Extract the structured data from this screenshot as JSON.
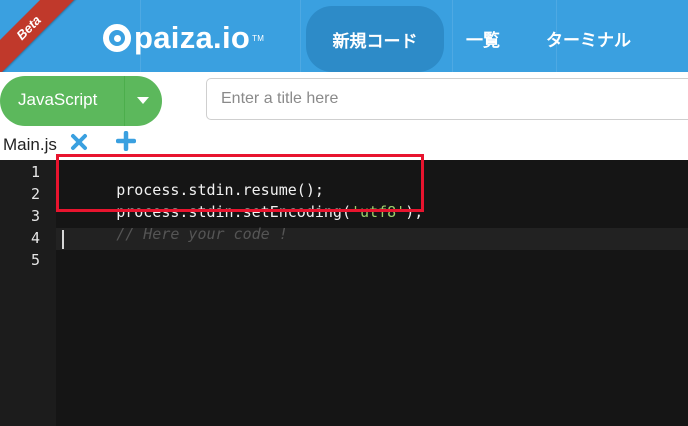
{
  "header": {
    "beta_label": "Beta",
    "logo_text": "paiza.io",
    "logo_tm": "TM",
    "nav": {
      "new_code": "新規コード",
      "list": "一覧",
      "terminal": "ターミナル"
    }
  },
  "toolbar": {
    "language": "JavaScript",
    "title_placeholder": "Enter a title here",
    "title_value": ""
  },
  "tabs": {
    "file_name": "Main.js"
  },
  "editor": {
    "line_numbers": [
      "1",
      "2",
      "3",
      "4",
      "5"
    ],
    "lines": [
      {
        "text": "process.stdin.resume();"
      },
      {
        "pre": "process.stdin.setEncoding(",
        "str": "'utf8'",
        "post": ");"
      },
      {
        "comment": "// Here your code !"
      },
      {
        "text": ""
      },
      {
        "text": ""
      }
    ]
  },
  "colors": {
    "header_bg": "#3aa0e0",
    "nav_active_bg": "#2d8bc8",
    "language_button": "#5cb85c",
    "highlight_border": "#e8142e",
    "string_color": "#9ccf6b",
    "close_icon": "#3aa0e0",
    "plus_icon": "#3aa0e0"
  },
  "icons": {
    "close": "close-icon",
    "add": "plus-icon",
    "dropdown": "chevron-down-icon"
  }
}
